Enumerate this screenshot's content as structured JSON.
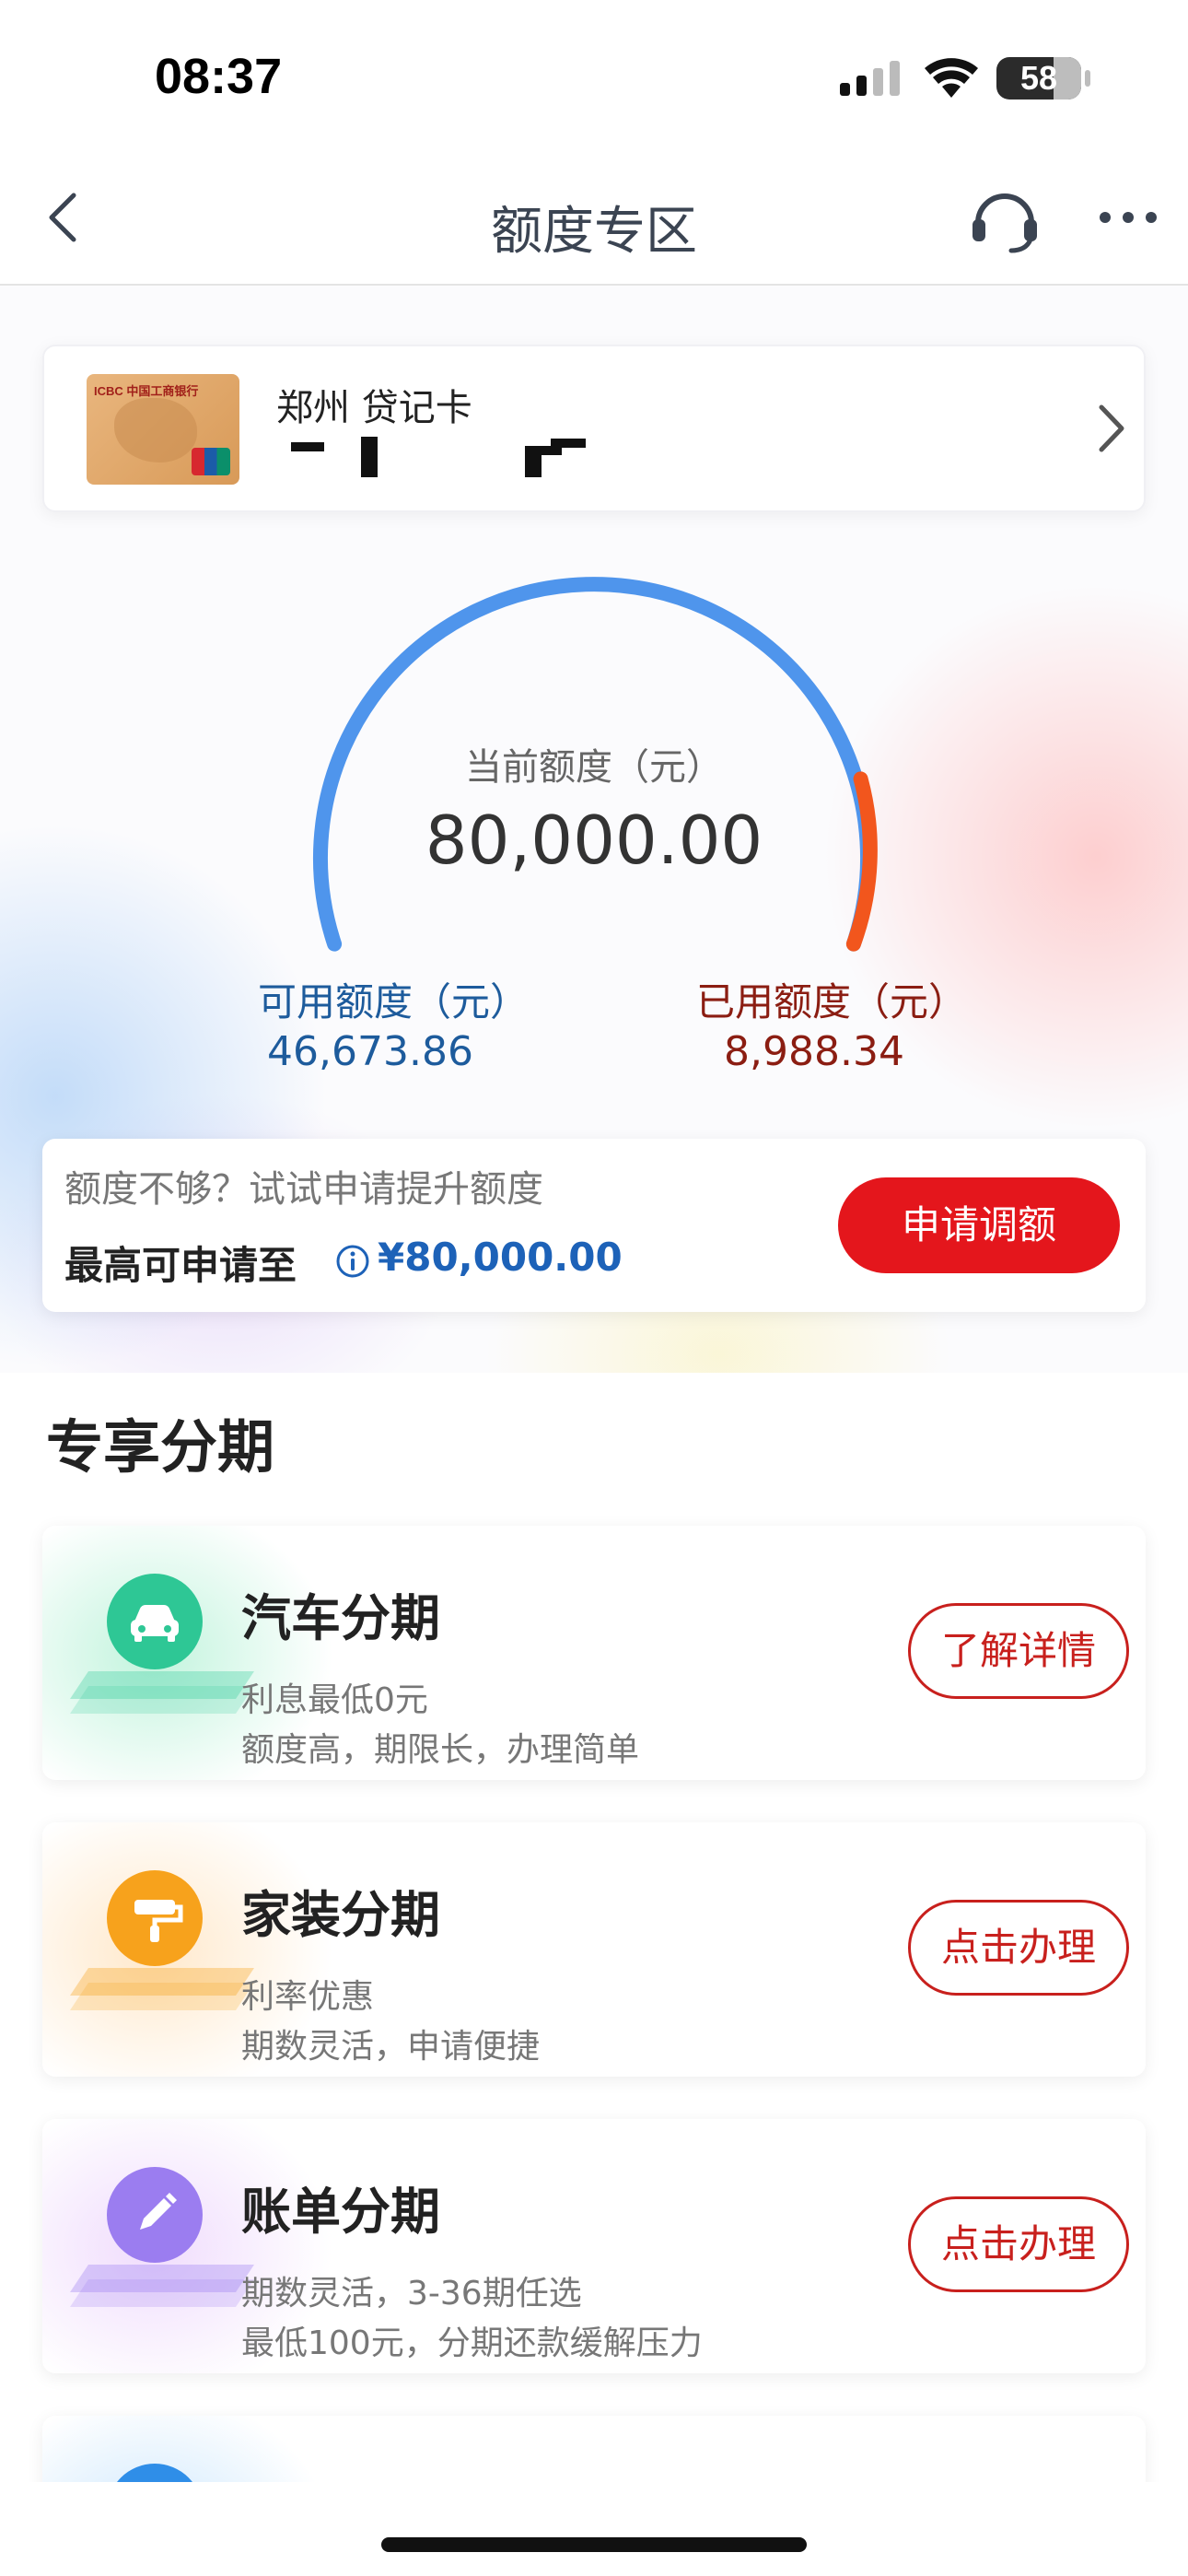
{
  "status_bar": {
    "time": "08:37",
    "battery": "58"
  },
  "nav": {
    "title": "额度专区"
  },
  "card": {
    "name": "郑州 贷记卡",
    "thumb_brand": "ICBC 中国工商银行"
  },
  "gauge": {
    "caption": "当前额度（元）",
    "total": "80,000.00",
    "available_label": "可用额度（元）",
    "available_value": "46,673.86",
    "used_label": "已用额度（元）",
    "used_value": "8,988.34",
    "colors": {
      "available": "#4f95ec",
      "used": "#f2561d"
    }
  },
  "limit": {
    "hint": "额度不够？试试申请提升额度",
    "max_label": "最高可申请至",
    "max_value": "¥80,000.00",
    "apply_label": "申请调额"
  },
  "section": {
    "title": "专享分期"
  },
  "promos": [
    {
      "title": "汽车分期",
      "line1": "利息最低0元",
      "line2": "额度高，期限长，办理简单",
      "button": "了解详情",
      "accent": "#2ec795",
      "icon": "car-icon"
    },
    {
      "title": "家装分期",
      "line1": "利率优惠",
      "line2": "期数灵活，申请便捷",
      "button": "点击办理",
      "accent": "#f7a21c",
      "icon": "paint-roller-icon"
    },
    {
      "title": "账单分期",
      "line1": "期数灵活，3-36期任选",
      "line2": "最低100元，分期还款缓解压力",
      "button": "点击办理",
      "accent": "#9b7df0",
      "icon": "pencil-icon"
    }
  ]
}
